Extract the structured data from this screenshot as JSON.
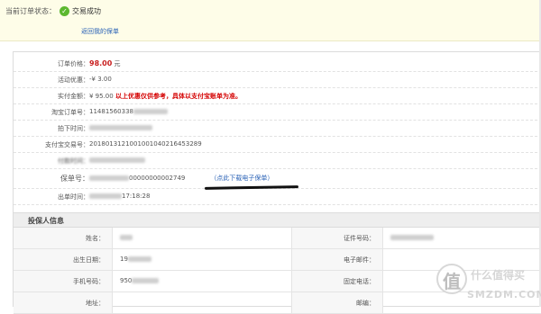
{
  "status": {
    "label": "当前订单状态：",
    "value": "交易成功",
    "back_link": "返回我的保单"
  },
  "order": {
    "price_label": "订单价格：",
    "price_value": "98.00",
    "price_unit": "元",
    "promo_label": "活动优惠：",
    "promo_value": "-¥ 3.00",
    "paid_label": "实付金额：",
    "paid_value": "¥ 95.00",
    "paid_note": "以上优惠仅供参考，具体以支付宝账单为准。",
    "taobao_no_label": "淘宝订单号：",
    "taobao_no_value": "11481560338",
    "ordered_time_label": "拍下时间：",
    "alipay_no_label": "支付宝交易号：",
    "alipay_no_value": "2018013121001001040216453289",
    "pay_time_label": "付款时间：",
    "policy_no_label": "保单号：",
    "policy_no_value": "00000000002749",
    "policy_download": "（点此下载电子保单）",
    "issue_time_label": "出单时间：",
    "issue_time_value": "17:18:28"
  },
  "holder": {
    "section_title": "投保人信息",
    "name_label": "姓名：",
    "id_label": "证件号码：",
    "birth_label": "出生日期：",
    "birth_value": "19",
    "email_label": "电子邮件：",
    "phone_label": "手机号码：",
    "phone_value": "950",
    "tel_label": "固定电话：",
    "address_label": "地址：",
    "postcode_label": "邮编："
  },
  "watermark": {
    "logo_char": "值",
    "text": "什么值得买",
    "sub": "SMZDM.COM"
  },
  "colors": {
    "accent": "#2a62b6",
    "price": "#c81e1e",
    "success": "#5cb82f",
    "status_bg": "#fefde8"
  }
}
